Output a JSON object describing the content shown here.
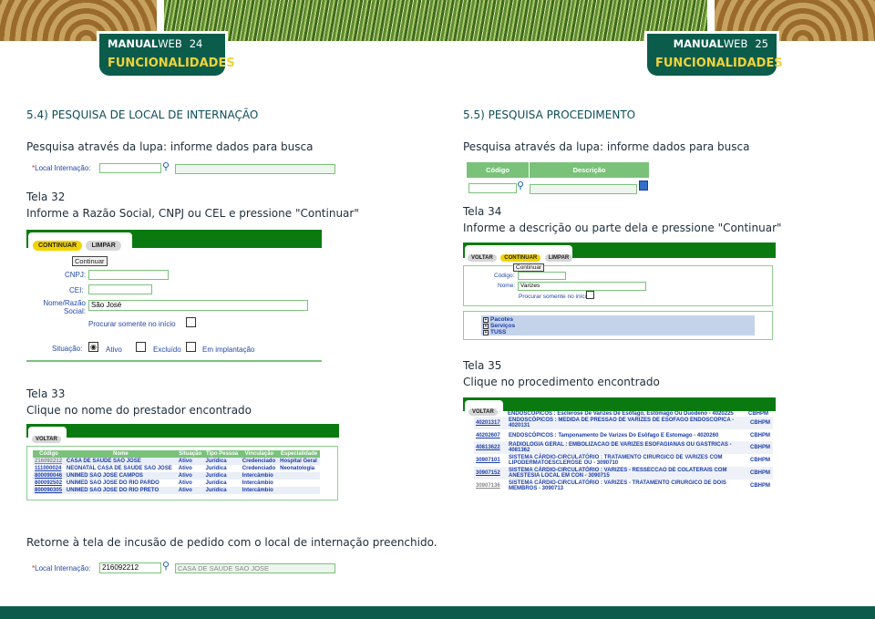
{
  "header": {
    "left": {
      "brand_bold": "MANUAL",
      "brand_light": "WEB",
      "page": "24",
      "section": "FUNCIONALIDADES"
    },
    "right": {
      "brand_bold": "MANUAL",
      "brand_light": "WEB",
      "page": "25",
      "section": "FUNCIONALIDADES"
    }
  },
  "left": {
    "heading": "5.4) PESQUISA DE LOCAL DE INTERNAÇÃO",
    "intro": "Pesquisa através da lupa: informe dados para busca",
    "field_label": "Local Internação:",
    "tela32": "Tela 32",
    "tela32_desc": "Informe a Razão Social, CNPJ ou CEL e pressione \"Continuar\"",
    "form": {
      "btn_continuar": "CONTINUAR",
      "btn_limpar": "LIMPAR",
      "tooltip": "Continuar",
      "cnpj": "CNPJ:",
      "cei": "CEI:",
      "nome_line1": "Nome/Razão",
      "nome_line2": "Social:",
      "nome_value": "São José",
      "procurar": "Procurar somente no início",
      "situacao": "Situação:",
      "opt_ativo": "Ativo",
      "opt_excluido": "Excluído",
      "opt_implantacao": "Em implantação"
    },
    "tela33": "Tela 33",
    "tela33_desc": "Clique no nome do prestador encontrado",
    "voltar": "VOLTAR",
    "table": {
      "headers": [
        "Código",
        "Nome",
        "Situação",
        "Tipo Pessoa",
        "Vinculação",
        "Especialidade"
      ],
      "rows": [
        [
          "216092212",
          "CASA DE SAUDE SAO JOSE",
          "Ativo",
          "Jurídica",
          "Credenciado",
          "Hospital Geral"
        ],
        [
          "111000024",
          "NEONATAL CASA DE SAUDE SAO JOSE",
          "Ativo",
          "Jurídica",
          "Credenciado",
          "Neonatologia"
        ],
        [
          "800090046",
          "UNIMED SAO JOSE CAMPOS",
          "Ativo",
          "Jurídica",
          "Intercâmbio",
          ""
        ],
        [
          "800092502",
          "UNIMED SAO JOSE DO RIO PARDO",
          "Ativo",
          "Jurídica",
          "Intercâmbio",
          ""
        ],
        [
          "800090305",
          "UNIMED SAO JOSE DO RIO PRETO",
          "Ativo",
          "Jurídica",
          "Intercâmbio",
          ""
        ]
      ]
    },
    "retorne": "Retorne à tela de incusão de pedido com o local de internação preenchido.",
    "final_code": "216092212",
    "final_name": "CASA DE SAUDE SAO JOSE"
  },
  "right": {
    "heading": "5.5) PESQUISA PROCEDIMENTO",
    "intro": "Pesquisa através da lupa: informe dados para busca",
    "col_codigo": "Código",
    "col_descricao": "Descrição",
    "tela34": "Tela 34",
    "tela34_desc": "Informe a descrição ou parte dela e pressione \"Continuar\"",
    "form": {
      "btn_voltar": "VOLTAR",
      "btn_continuar": "CONTINUAR",
      "btn_limpar": "LIMPAR",
      "tooltip": "Continuar",
      "codigo": "Código:",
      "nome": "Nome:",
      "nome_value": "Varizes",
      "procurar": "Procurar somente no início",
      "tree": [
        "Pacotes",
        "Serviços",
        "TUSS"
      ]
    },
    "tela35": "Tela 35",
    "tela35_desc": "Clique no procedimento encontrado",
    "voltar": "VOLTAR",
    "cut_row": "ENDOSCÓPICOS : Esclerose De Varizes De Esôfago, Estômago Ou Duodeno - 4020225",
    "cut_tab": "CBHPM",
    "rows": [
      {
        "code": "40201317",
        "desc": "ENDOSCÓPICOS : MEDIDA DE PRESSAO DE VARIZES DE ESOFAGO ENDOSCOPICA - 4020131",
        "tab": "CBHPM"
      },
      {
        "code": "40202607",
        "desc": "ENDOSCÓPICOS : Tamponamento De Varizes Do Esôfago E Estomago - 4020260",
        "tab": "CBHPM"
      },
      {
        "code": "40813622",
        "desc": "RADIOLOGIA GERAL : EMBOLIZACAO DE VARIZES ESOFAGIANAS OU GASTRICAS - 4081362",
        "tab": "CBHPM"
      },
      {
        "code": "30907101",
        "desc": "SISTEMA CÁRDIO-CIRCULATÓRIO : TRATAMENTO CIRURGICO DE VARIZES COM LIPODERMATOESCLEROSE OU - 3090710",
        "tab": "CBHPM"
      },
      {
        "code": "30907152",
        "desc": "SISTEMA CÁRDIO-CIRCULATÓRIO : VARIZES - RESSECCAO DE COLATERAIS COM ANESTESIA LOCAL EM CON - 3090715",
        "tab": "CBHPM"
      },
      {
        "code": "30907136",
        "desc": "SISTEMA CÁRDIO-CIRCULATÓRIO : VARIZES - TRATAMENTO CIRURGICO DE DOIS MEMBROS - 3090713",
        "tab": "CBHPM"
      }
    ]
  }
}
